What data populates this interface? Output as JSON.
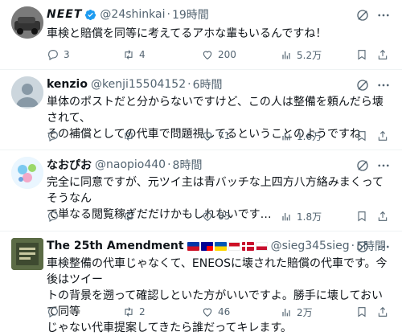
{
  "tweets": [
    {
      "name": "NEET",
      "handle": "@24shinkai",
      "time": "19時間",
      "text": "車検と賠償を同等に考えてるアホな輩もいるんですね！",
      "replies": "3",
      "retweets": "4",
      "likes": "200",
      "views": "5.2万"
    },
    {
      "name": "kenzio",
      "handle": "@kenji15504152",
      "time": "6時間",
      "text_line1": "単体のポストだと分からないですけど、この人は整備を頼んだら壊されて、",
      "text_line2": "その補償としての代車で問題視してるということのようですね",
      "replies": "",
      "retweets": "",
      "likes": "71",
      "views": "1.6万"
    },
    {
      "name": "なおぴお",
      "handle": "@naopio440",
      "time": "8時間",
      "text_line1": "完全に同意ですが、元ツイ主は青バッチな上四方八方絡みまくってそうなん",
      "text_line2": "で単なる閲覧稼ぎだだけかもしれないです…",
      "replies": "",
      "retweets": "",
      "likes": "65",
      "views": "1.8万"
    },
    {
      "name": "The 25th Amendment",
      "handle": "@sieg345sieg",
      "time": "5時間",
      "text_line1": "車検整備の代車じゃなくて、ENEOSに壊された賠償の代車です。今後はツイー",
      "text_line2": "トの背景を遡って確認しといた方がいいですよ。勝手に壊しておいて同等",
      "text_line3": "じゃない代車提案してきたら誰だってキレます。",
      "replies": "",
      "retweets": "2",
      "likes": "46",
      "views": "2万"
    }
  ],
  "colors": {
    "text": "#0f1419",
    "secondary": "#536471",
    "verified": "#1d9bf0",
    "divider": "#eff3f4"
  }
}
